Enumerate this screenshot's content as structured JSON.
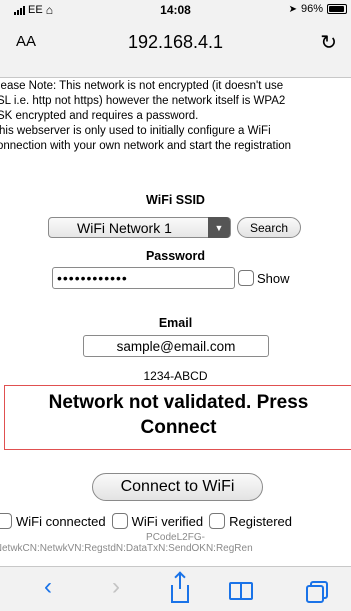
{
  "status_bar": {
    "carrier": "EE",
    "time": "14:08",
    "battery": "96%"
  },
  "browser": {
    "text_size_label": "AA",
    "url": "192.168.4.1"
  },
  "note": {
    "lines": [
      "lease Note: This network is not encrypted (it doesn't use",
      "SL i.e. http not https) however the network itself is WPA2",
      "SK encrypted and requires a password.",
      "his webserver is only used to initially configure a WiFi",
      "onnection with your own network and start the registration"
    ]
  },
  "form": {
    "ssid_label": "WiFi SSID",
    "ssid_selected": "WiFi Network 1",
    "search_label": "Search",
    "password_label": "Password",
    "password_value": "••••••••••••",
    "show_label": "Show",
    "email_label": "Email",
    "email_value": "sample@email.com",
    "device_code": "1234-ABCD"
  },
  "status": {
    "message_line1": "Network not validated. Press",
    "message_line2": "Connect"
  },
  "actions": {
    "connect_label": "Connect to WiFi"
  },
  "checks": {
    "connected": "WiFi connected",
    "verified": "WiFi verified",
    "registered": "Registered"
  },
  "footer": {
    "pcode": "PCodeL2FG-",
    "codes": ":NetwkCN:NetwkVN:RegstdN:DataTxN:SendOKN:RegRen"
  },
  "colors": {
    "accent": "#1a73e8",
    "status_border": "#e05050",
    "muted_text": "#8a8a8a"
  }
}
